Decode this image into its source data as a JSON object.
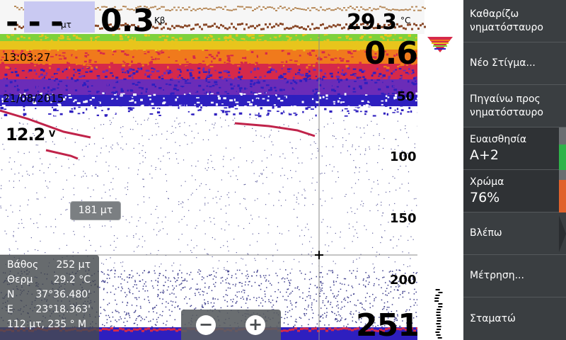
{
  "readouts": {
    "speed_value": "- - -",
    "speed_unit": "μτ",
    "sog_value": "0.3",
    "sog_unit": "Κβ",
    "water_temp_value": "29.3",
    "water_temp_unit": "°C",
    "depth_top_value": "0.6",
    "depth_bottom_value": "251",
    "time": "13:03:27",
    "date": "21/08/2015",
    "fish_depth": "12.2",
    "fish_unit": "V",
    "cursor_range": "181 μτ"
  },
  "depth_scale": [
    "50",
    "100",
    "150",
    "200"
  ],
  "info_panel": {
    "rows": [
      {
        "key": "Βάθος",
        "value": "252 μτ"
      },
      {
        "key": "Θερμ",
        "value": "29.2 °C"
      },
      {
        "key": "N",
        "value": "37°36.480'"
      },
      {
        "key": "E",
        "value": "23°18.363'"
      },
      {
        "key": "",
        "value": "112 μτ, 235 ° M"
      }
    ]
  },
  "zoom": {
    "minus_label": "−",
    "plus_label": "+"
  },
  "menu": {
    "items": [
      {
        "line1": "Καθαρίζω",
        "line2": "νηματόσταυρο"
      },
      {
        "line1": "Νέο Στίγμα...",
        "line2": ""
      },
      {
        "line1": "Πηγαίνω προς",
        "line2": "νηματόσταυρο"
      },
      {
        "line1": "Ευαισθησία",
        "line2": "A+2"
      },
      {
        "line1": "Χρώμα",
        "line2": "76%"
      },
      {
        "line1": "Βλέπω",
        "line2": ""
      },
      {
        "line1": "Μέτρηση...",
        "line2": ""
      },
      {
        "line1": "Σταματώ",
        "line2": ""
      }
    ]
  },
  "colors": {
    "menu_bg": "#3a3e41",
    "sensitivity_bar": "#2fb34a",
    "color_bar": "#e0622c",
    "sonar_band": [
      "#2e1fbf",
      "#6b2cb8",
      "#d6294a",
      "#f07a1c",
      "#e8c51c",
      "#7ed13b"
    ]
  }
}
